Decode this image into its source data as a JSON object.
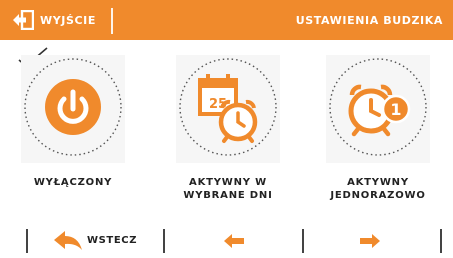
{
  "header": {
    "exit_label": "WYJŚCIE",
    "title": "USTAWIENIA BUDZIKA",
    "bar_color": "#f08a2c",
    "exit_icon": "exit-door-icon"
  },
  "selection": {
    "icon": "checkmark-icon",
    "selected_option": "off"
  },
  "options": [
    {
      "id": "off",
      "icon": "power-icon",
      "label_lines": [
        "WYŁĄCZONY"
      ]
    },
    {
      "id": "selected_days",
      "icon": "calendar-alarm-icon",
      "calendar_day": "25",
      "label_lines": [
        "AKTYWNY W",
        "WYBRANE DNI"
      ]
    },
    {
      "id": "once",
      "icon": "alarm-clock-one-icon",
      "badge": "1",
      "label_lines": [
        "AKTYWNY",
        "JEDNORAZOWO"
      ]
    }
  ],
  "footer": {
    "back_label": "WSTECZ",
    "back_icon": "back-arrow-icon",
    "prev_icon": "arrow-left-icon",
    "next_icon": "arrow-right-icon"
  },
  "accent_color": "#f08a2c"
}
